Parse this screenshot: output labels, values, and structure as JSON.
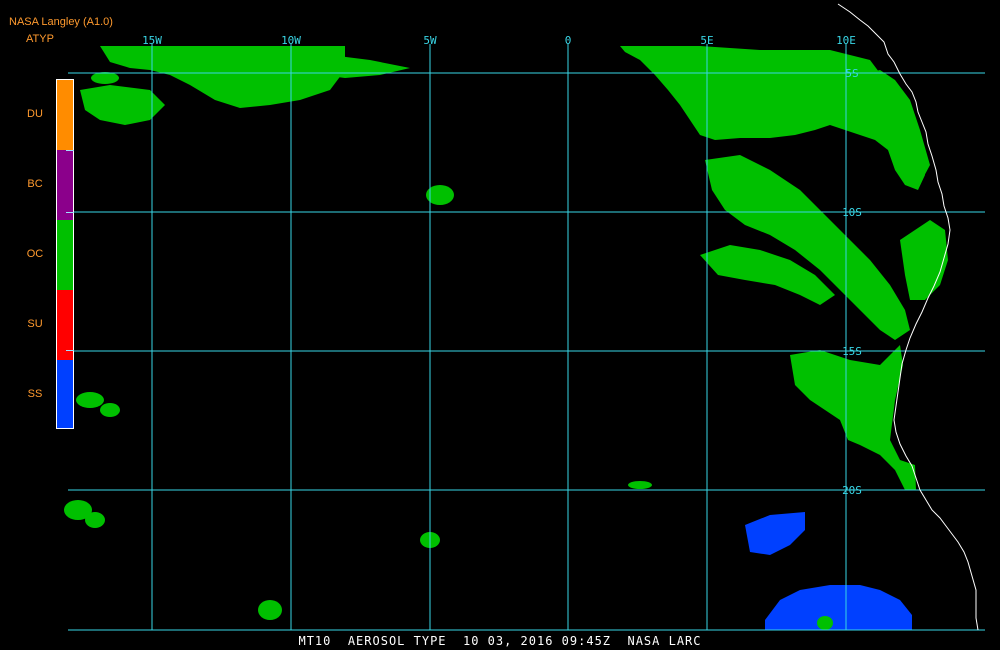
{
  "header": {
    "title": "NASA Langley (A1.0)",
    "product": "ATYP"
  },
  "legend": [
    {
      "code": "DU",
      "color": "#ff8c00"
    },
    {
      "code": "BC",
      "color": "#8b008b"
    },
    {
      "code": "OC",
      "color": "#00c000"
    },
    {
      "code": "SU",
      "color": "#ff0000"
    },
    {
      "code": "SS",
      "color": "#0040ff"
    }
  ],
  "grid": {
    "color": "#39d6e6",
    "lon_labels": [
      "15W",
      "10W",
      "5W",
      "0",
      "5E",
      "10E"
    ],
    "lat_labels": [
      "5S",
      "10S",
      "15S",
      "20S"
    ]
  },
  "coastline_color": "#ffffff",
  "footer": "MT10  AEROSOL TYPE  10 03, 2016 09:45Z  NASA LARC"
}
